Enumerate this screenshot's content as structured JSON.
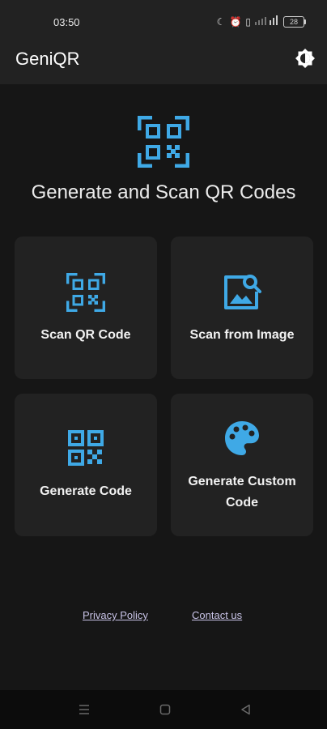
{
  "status_bar": {
    "time": "03:50",
    "battery": "28"
  },
  "app_bar": {
    "title": "GeniQR",
    "theme_toggle_icon": "brightness-icon"
  },
  "hero": {
    "icon": "qr-scan-icon",
    "title": "Generate and Scan QR Codes"
  },
  "cards": [
    {
      "label": "Scan QR Code",
      "icon": "qr-scan-icon"
    },
    {
      "label": "Scan from Image",
      "icon": "image-search-icon"
    },
    {
      "label": "Generate Code",
      "icon": "qr-code-icon"
    },
    {
      "label_line1": "Generate Custom",
      "label_line2": "Code",
      "icon": "palette-icon"
    }
  ],
  "links": {
    "privacy": "Privacy Policy",
    "contact": "Contact us"
  },
  "colors": {
    "accent": "#3fa9e6",
    "background": "#161616",
    "surface": "#222222",
    "link": "#c9c4e8"
  }
}
